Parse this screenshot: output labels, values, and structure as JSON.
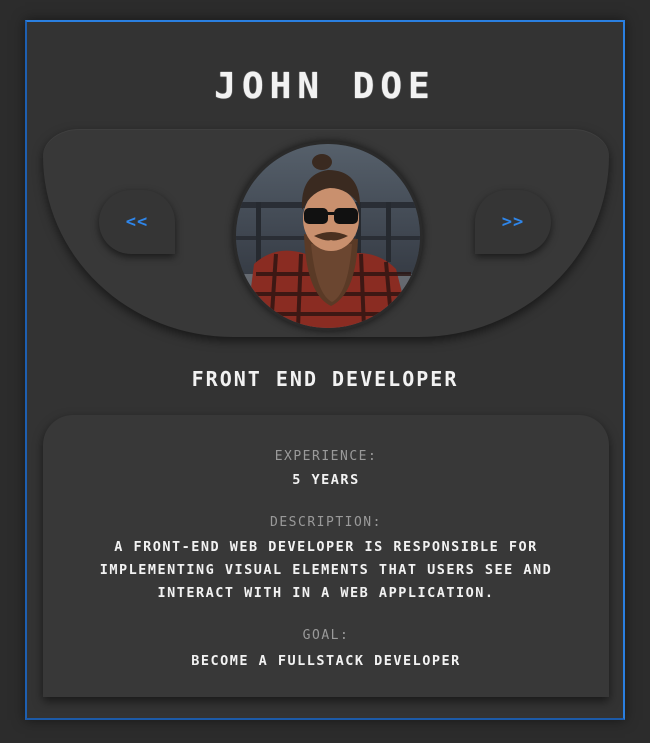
{
  "profile": {
    "name": "JOHN DOE",
    "role": "FRONT END DEVELOPER",
    "avatar_alt": "profile-photo"
  },
  "carousel": {
    "prev_label": "<<",
    "next_label": ">>"
  },
  "details": {
    "experience_label": "EXPERIENCE:",
    "experience_value": "5 YEARS",
    "description_label": "DESCRIPTION:",
    "description_value": "A FRONT-END WEB DEVELOPER IS RESPONSIBLE FOR IMPLEMENTING VISUAL ELEMENTS THAT USERS SEE AND INTERACT WITH IN A WEB APPLICATION.",
    "goal_label": "GOAL:",
    "goal_value": "BECOME A FULLSTACK DEVELOPER"
  },
  "colors": {
    "accent": "#2a7fe0",
    "background": "#2c2c2c",
    "card": "#333333"
  }
}
